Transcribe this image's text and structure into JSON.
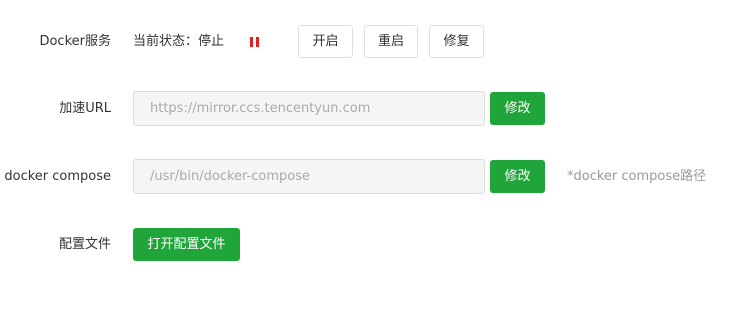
{
  "docker_service": {
    "label": "Docker服务",
    "status_text": "当前状态：停止",
    "status_icon": "pause-icon",
    "status_color": "#e02020",
    "buttons": {
      "start": "开启",
      "restart": "重启",
      "repair": "修复"
    }
  },
  "mirror_url": {
    "label": "加速URL",
    "value": "https://mirror.ccs.tencentyun.com",
    "modify_label": "修改"
  },
  "docker_compose": {
    "label": "docker compose",
    "value": "/usr/bin/docker-compose",
    "modify_label": "修改",
    "hint": "*docker compose路径"
  },
  "config_file": {
    "label": "配置文件",
    "open_label": "打开配置文件"
  },
  "colors": {
    "accent": "#20a53a",
    "input_bg": "#f5f5f5",
    "border": "#dcdfe6"
  }
}
